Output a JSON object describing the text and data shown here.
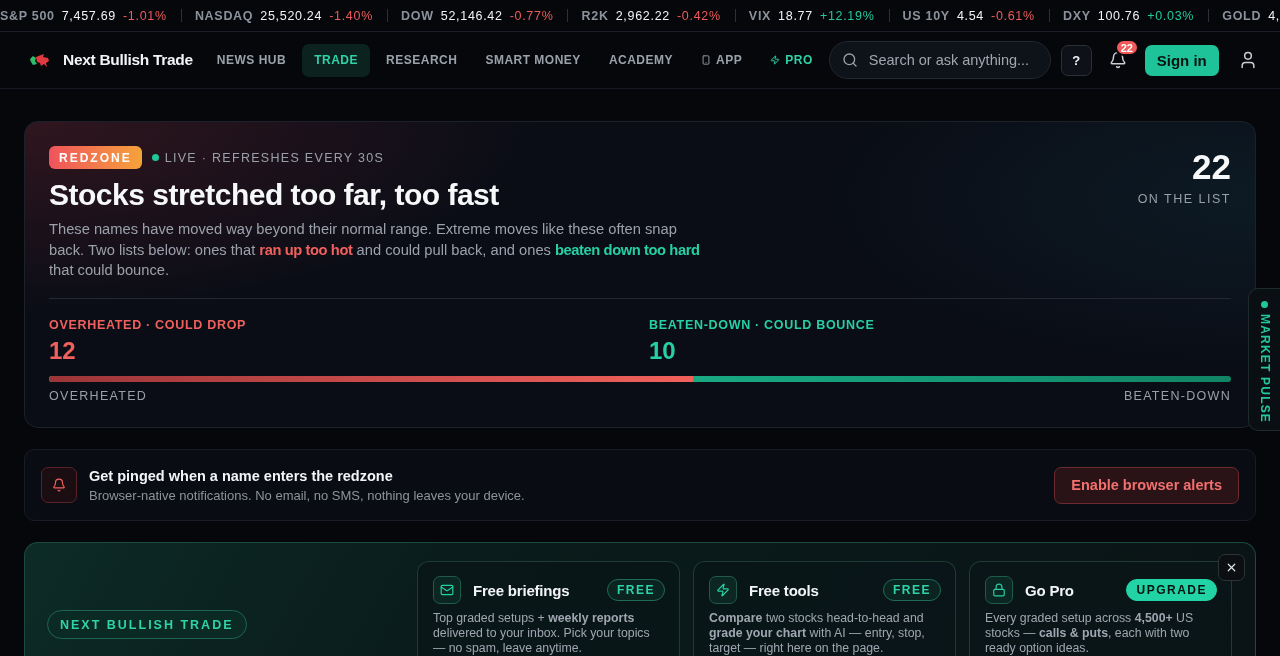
{
  "ticker": [
    {
      "label": "S&P 500",
      "value": "7,457.69",
      "change": "-1.01%",
      "kind": "down"
    },
    {
      "label": "NASDAQ",
      "value": "25,520.24",
      "change": "-1.40%",
      "kind": "down"
    },
    {
      "label": "DOW",
      "value": "52,146.42",
      "change": "-0.77%",
      "kind": "down"
    },
    {
      "label": "R2K",
      "value": "2,962.22",
      "change": "-0.42%",
      "kind": "down"
    },
    {
      "label": "VIX",
      "value": "18.77",
      "change": "+12.19%",
      "kind": "up"
    },
    {
      "label": "US 10Y",
      "value": "4.54",
      "change": "-0.61%",
      "kind": "down"
    },
    {
      "label": "DXY",
      "value": "100.76",
      "change": "+0.03%",
      "kind": "up"
    },
    {
      "label": "GOLD",
      "value": "4,"
    }
  ],
  "nav": {
    "brand": "Next Bullish Trade",
    "links": [
      {
        "label": "NEWS HUB",
        "kind": "plain",
        "selected": false
      },
      {
        "label": "TRADE",
        "kind": "plain",
        "selected": true
      },
      {
        "label": "RESEARCH",
        "kind": "plain",
        "selected": false
      },
      {
        "label": "SMART MONEY",
        "kind": "plain",
        "selected": false
      },
      {
        "label": "ACADEMY",
        "kind": "plain",
        "selected": false
      },
      {
        "label": "APP",
        "kind": "app",
        "selected": false
      },
      {
        "label": "PRO",
        "kind": "pro",
        "selected": false
      }
    ],
    "search": {
      "placeholder": "Search or ask anything..."
    },
    "help": "?",
    "notifications": {
      "count": "22"
    },
    "sign_in": "Sign in"
  },
  "hero": {
    "badge": "REDZONE",
    "live": true,
    "status": "LIVE · REFRESHES EVERY 30S",
    "title": "Stocks stretched too far, too fast",
    "description": [
      {
        "text": "These names have moved way beyond their normal range. Extreme moves like these often snap back. Two lists below: ones that ",
        "kind": "plain"
      },
      {
        "text": "ran up too hot",
        "kind": "hot"
      },
      {
        "text": " and could pull back, and ones ",
        "kind": "plain"
      },
      {
        "text": "beaten down too hard",
        "kind": "cold"
      },
      {
        "text": " that could bounce.",
        "kind": "plain"
      }
    ],
    "count": "22",
    "count_label": "ON THE LIST",
    "groups": [
      {
        "label": "OVERHEATED · COULD DROP",
        "count": "12",
        "kind": "hot"
      },
      {
        "label": "BEATEN-DOWN · COULD BOUNCE",
        "count": "10",
        "kind": "cold"
      }
    ],
    "balance": {
      "level": 0.545,
      "left_label": "OVERHEATED",
      "right_label": "BEATEN-DOWN"
    }
  },
  "side_tab": {
    "label": "MARKET PULSE"
  },
  "alert": {
    "title": "Get pinged when a name enters the redzone",
    "subtitle": "Browser-native notifications. No email, no SMS, nothing leaves your device.",
    "button": "Enable browser alerts"
  },
  "promo": {
    "tag": "NEXT BULLISH TRADE",
    "dismissible": true,
    "cards": [
      {
        "kind": "mail",
        "title": "Free briefings",
        "badge": {
          "label": "FREE",
          "filled": false
        },
        "description": "Top graded setups + **weekly reports** delivered to your inbox. Pick your topics — no spam, leave anytime."
      },
      {
        "kind": "bolt",
        "title": "Free tools",
        "badge": {
          "label": "FREE",
          "filled": false
        },
        "description": "**Compare** two stocks head-to-head and **grade your chart** with AI — entry, stop, target — right here on the page."
      },
      {
        "kind": "lock",
        "title": "Go Pro",
        "badge": {
          "label": "UPGRADE",
          "filled": true
        },
        "description": "Every graded setup across **4,500+** US stocks — **calls & puts**, each with two ready option ideas."
      }
    ]
  }
}
